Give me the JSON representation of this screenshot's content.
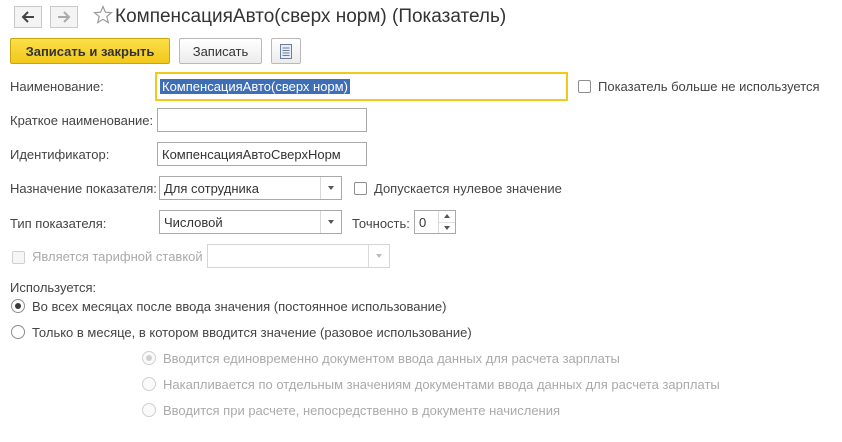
{
  "window": {
    "title": "КомпенсацияАвто(сверх норм) (Показатель)"
  },
  "nav": {
    "back_icon": "arrow-left-icon",
    "forward_icon": "arrow-right-icon",
    "favorite_icon": "star-icon"
  },
  "toolbar": {
    "save_close_label": "Записать и закрыть",
    "save_label": "Записать",
    "list_icon": "document-list-icon"
  },
  "form": {
    "name": {
      "label": "Наименование:",
      "value": "КомпенсацияАвто(сверх норм)"
    },
    "not_used": {
      "label": "Показатель больше не используется",
      "checked": false
    },
    "short_name": {
      "label": "Краткое наименование:",
      "value": ""
    },
    "identifier": {
      "label": "Идентификатор:",
      "value": "КомпенсацияАвтоСверхНорм"
    },
    "purpose": {
      "label": "Назначение показателя:",
      "value": "Для сотрудника"
    },
    "zero_allowed": {
      "label": "Допускается нулевое значение",
      "checked": false
    },
    "type": {
      "label": "Тип показателя:",
      "value": "Числовой"
    },
    "precision": {
      "label": "Точность:",
      "value": "0"
    },
    "tariff": {
      "label": "Является тарифной ставкой",
      "checked": false,
      "value": ""
    },
    "usage": {
      "label": "Используется:",
      "options": [
        {
          "label": "Во всех месяцах после ввода значения (постоянное использование)",
          "selected": true
        },
        {
          "label": "Только в месяце, в котором вводится значение (разовое использование)",
          "selected": false
        }
      ],
      "sub_options": [
        {
          "label": "Вводится единовременно документом ввода данных для расчета зарплаты",
          "selected": true
        },
        {
          "label": "Накапливается по отдельным значениям документами ввода данных для расчета зарплаты",
          "selected": false
        },
        {
          "label": "Вводится при расчете, непосредственно в документе начисления",
          "selected": false
        }
      ]
    }
  },
  "colors": {
    "accent": "#f2c81a",
    "selection": "#3e6fb6"
  }
}
